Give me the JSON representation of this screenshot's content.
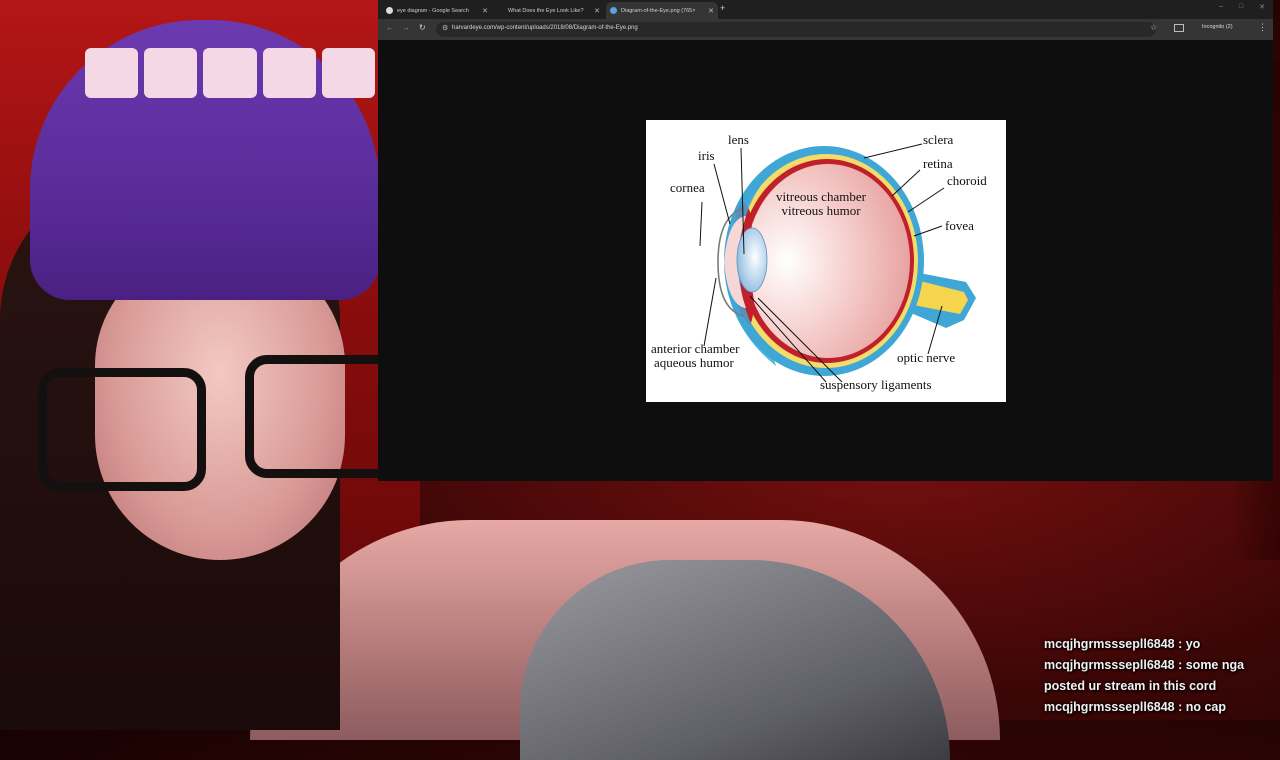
{
  "browser": {
    "tabs": [
      {
        "title": "eye diagram - Google Search",
        "favicon": "google-icon",
        "active": false
      },
      {
        "title": "What Does the Eye Look Like?",
        "favicon": "page-icon",
        "active": false
      },
      {
        "title": "Diagram-of-the-Eye.png (765×",
        "favicon": "wordpress-icon",
        "active": true
      }
    ],
    "new_tab": "+",
    "window_controls": [
      "–",
      "□",
      "✕"
    ],
    "url": "harvardeye.com/wp-content/uploads/2018/08/Diagram-of-the-Eye.png",
    "profile": "Incognito (2)",
    "nav": {
      "back": "←",
      "forward": "→",
      "reload": "↻"
    }
  },
  "diagram": {
    "labels": {
      "lens": "lens",
      "iris": "iris",
      "cornea": "cornea",
      "sclera": "sclera",
      "retina": "retina",
      "choroid": "choroid",
      "vitreous_chamber": "vitreous chamber",
      "vitreous_humor": "vitreous humor",
      "fovea": "fovea",
      "anterior_chamber": "anterior chamber",
      "aqueous_humor": "aqueous humor",
      "optic_nerve": "optic nerve",
      "suspensory_ligaments": "suspensory ligaments"
    },
    "colors": {
      "sclera": "#3fa7d6",
      "choroid": "#f3dc6a",
      "retina": "#c0202a",
      "vitreous": "#f3c6c4",
      "lens": "#9fc8e8",
      "optic_nerve": "#f5d54e"
    }
  },
  "chat": [
    {
      "user": "mcqjhgrmsssepll6848",
      "text": "yo"
    },
    {
      "user": "mcqjhgrmsssepll6848",
      "text": "some nga posted ur stream in this cord"
    },
    {
      "user": "mcqjhgrmsssepll6848",
      "text": "no cap"
    }
  ]
}
